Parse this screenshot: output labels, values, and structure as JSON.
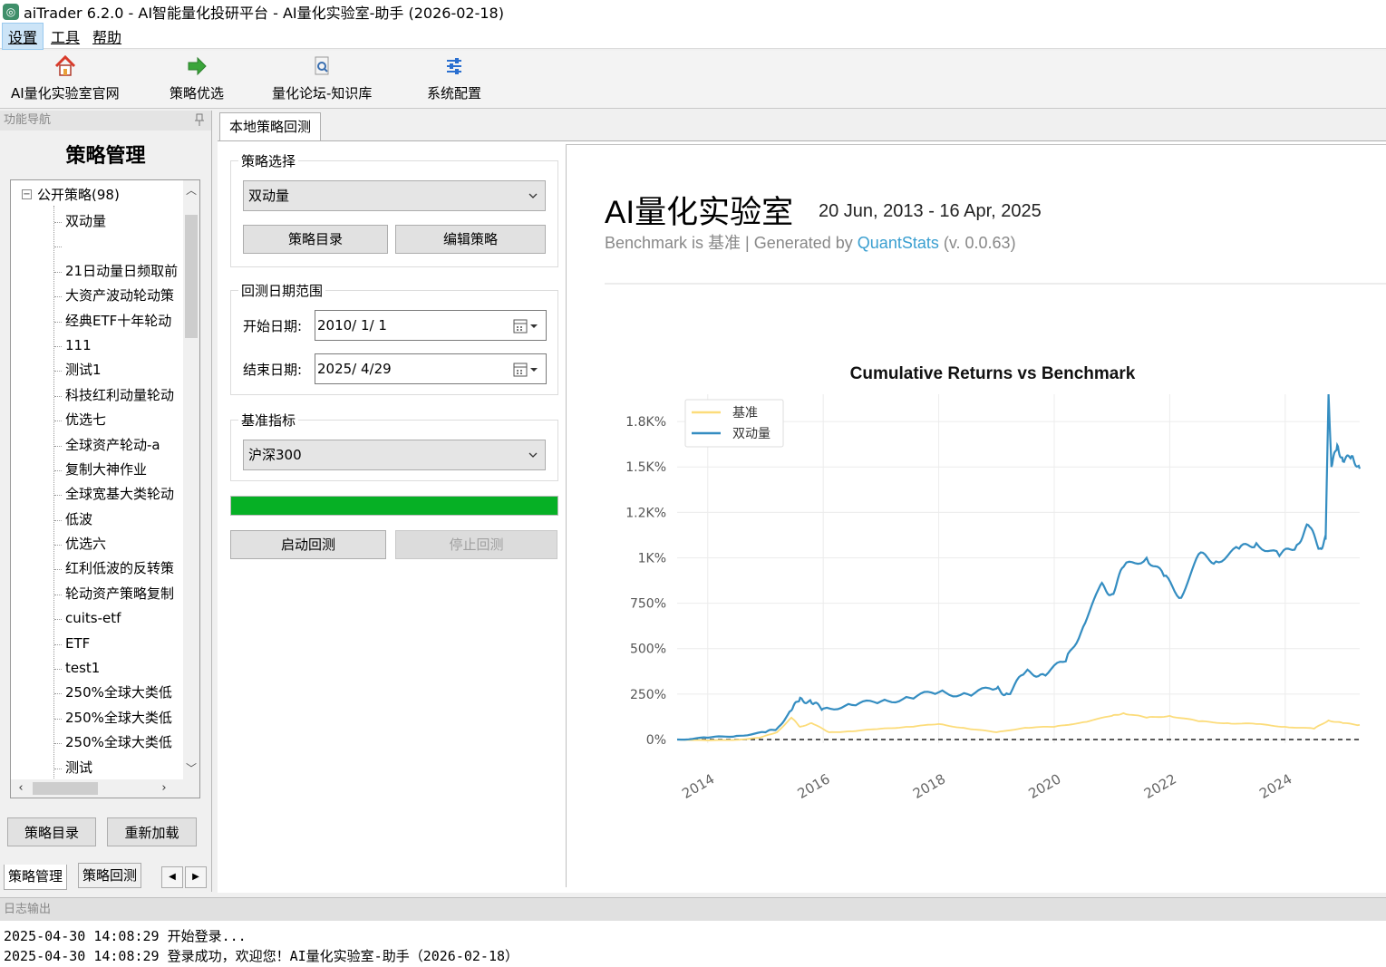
{
  "window": {
    "title": "aiTrader 6.2.0 - AI智能量化投研平台 - AI量化实验室-助手 (2026-02-18)"
  },
  "menu": [
    {
      "label": "设置",
      "active": true
    },
    {
      "label": "工具",
      "active": false
    },
    {
      "label": "帮助",
      "active": false
    }
  ],
  "toolbar": {
    "home": "AI量化实验室官网",
    "optimize": "策略优选",
    "forum": "量化论坛-知识库",
    "config": "系统配置"
  },
  "left_panel": {
    "header": "功能导航",
    "title": "策略管理",
    "tree_root": "公开策略(98)",
    "tree_items": [
      "双动量",
      "",
      "21日动量日频取前",
      "大资产波动轮动策",
      "经典ETF十年轮动",
      "111",
      "测试1",
      "科技红利动量轮动",
      "优选七",
      "全球资产轮动-a",
      "复制大神作业",
      "全球宽基大类轮动",
      "低波",
      "优选六",
      "红利低波的反转策",
      "轮动资产策略复制",
      "cuits-etf",
      "ETF",
      "test1",
      "250%全球大类低",
      "250%全球大类低",
      "250%全球大类低",
      "测试"
    ],
    "btn_catalog": "策略目录",
    "btn_reload": "重新加载",
    "tab_manage": "策略管理",
    "tab_backtest": "策略回测"
  },
  "main": {
    "tab": "本地策略回测",
    "strategy_group": "策略选择",
    "strategy_selected": "双动量",
    "btn_catalog": "策略目录",
    "btn_edit": "编辑策略",
    "date_group": "回测日期范围",
    "start_label": "开始日期:",
    "start_value": "2010/  1/  1",
    "end_label": "结束日期:",
    "end_value": "2025/  4/29",
    "bench_group": "基准指标",
    "bench_selected": "沪深300",
    "progress": 1.0,
    "btn_start": "启动回测",
    "btn_stop": "停止回测"
  },
  "report": {
    "title": "AI量化实验室",
    "dates": "20 Jun, 2013 - 16 Apr, 2025",
    "sub_prefix": "Benchmark is 基准 | Generated by ",
    "sub_link": "QuantStats",
    "sub_suffix": " (v. 0.0.63)"
  },
  "chart_data": {
    "type": "line",
    "title": "Cumulative Returns vs Benchmark",
    "x_ticks": [
      "2014",
      "2016",
      "2018",
      "2020",
      "2022",
      "2024"
    ],
    "y_ticks": [
      "0%",
      "250%",
      "500%",
      "750%",
      "1K%",
      "1.2K%",
      "1.5K%",
      "1.8K%"
    ],
    "y_tick_values": [
      0,
      250,
      500,
      750,
      1000,
      1250,
      1500,
      1750
    ],
    "ylim": [
      -20,
      1900
    ],
    "xlim": [
      2013.47,
      2025.29
    ],
    "legend_placement": "top-left",
    "grid": true,
    "colors": {
      "benchmark": "#fcdc7a",
      "strategy": "#348dc1"
    },
    "series": [
      {
        "name": "基准",
        "x": [
          2013.47,
          2014.0,
          2014.5,
          2014.9,
          2015.2,
          2015.45,
          2015.6,
          2015.8,
          2016.1,
          2016.5,
          2017.0,
          2017.5,
          2018.0,
          2018.5,
          2019.0,
          2019.5,
          2020.0,
          2020.5,
          2021.0,
          2021.2,
          2021.6,
          2022.0,
          2022.5,
          2023.0,
          2023.5,
          2024.0,
          2024.5,
          2024.75,
          2025.0,
          2025.29
        ],
        "values": [
          0,
          -5,
          -2,
          10,
          40,
          120,
          70,
          90,
          40,
          45,
          60,
          70,
          85,
          60,
          40,
          65,
          70,
          95,
          130,
          145,
          120,
          130,
          100,
          90,
          85,
          70,
          60,
          105,
          90,
          80
        ]
      },
      {
        "name": "双动量",
        "x": [
          2013.47,
          2014.0,
          2014.5,
          2015.0,
          2015.2,
          2015.45,
          2015.6,
          2015.8,
          2016.0,
          2016.5,
          2017.0,
          2017.5,
          2018.0,
          2018.5,
          2019.0,
          2019.2,
          2019.5,
          2019.8,
          2020.2,
          2020.5,
          2020.8,
          2021.0,
          2021.2,
          2021.6,
          2021.9,
          2022.2,
          2022.5,
          2022.8,
          2023.2,
          2023.5,
          2023.9,
          2024.2,
          2024.4,
          2024.6,
          2024.7,
          2024.75,
          2024.8,
          2024.9,
          2025.0,
          2025.15,
          2025.29
        ],
        "values": [
          0,
          10,
          20,
          40,
          60,
          160,
          230,
          200,
          170,
          190,
          210,
          230,
          260,
          250,
          280,
          250,
          370,
          360,
          430,
          620,
          850,
          800,
          950,
          1000,
          900,
          780,
          1020,
          980,
          1050,
          1080,
          1010,
          1070,
          1180,
          1050,
          1100,
          1900,
          1500,
          1620,
          1530,
          1560,
          1490
        ]
      }
    ]
  },
  "log": {
    "header": "日志输出",
    "lines": [
      "2025-04-30 14:08:29 开始登录...",
      "2025-04-30 14:08:29 登录成功，欢迎您！AI量化实验室-助手（2026-02-18）"
    ]
  }
}
